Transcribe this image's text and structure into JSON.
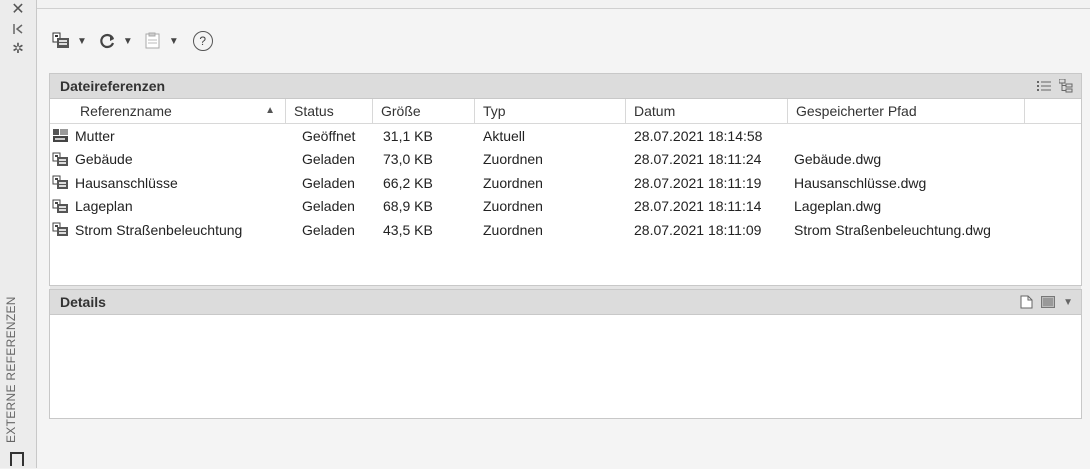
{
  "side": {
    "vertical_title": "EXTERNE REFERENZEN",
    "close_icon": "close-icon",
    "pin_icon": "pin-icon",
    "settings_icon": "settings-icon"
  },
  "toolbar": {
    "attach_icon": "attach-dwg-icon",
    "refresh_icon": "refresh-icon",
    "change_path_icon": "change-path-icon",
    "help_label": "?"
  },
  "file_refs": {
    "title": "Dateireferenzen",
    "columns": [
      "Referenzname",
      "Status",
      "Größe",
      "Typ",
      "Datum",
      "Gespeicherter Pfad"
    ],
    "rows": [
      {
        "name": "Mutter",
        "status": "Geöffnet",
        "size": "31,1 KB",
        "type": "Aktuell",
        "date": "28.07.2021 18:14:58",
        "path": ""
      },
      {
        "name": "Gebäude",
        "status": "Geladen",
        "size": "73,0 KB",
        "type": "Zuordnen",
        "date": "28.07.2021 18:11:24",
        "path": "Gebäude.dwg"
      },
      {
        "name": "Hausanschlüsse",
        "status": "Geladen",
        "size": "66,2 KB",
        "type": "Zuordnen",
        "date": "28.07.2021 18:11:19",
        "path": "Hausanschlüsse.dwg"
      },
      {
        "name": "Lageplan",
        "status": "Geladen",
        "size": "68,9 KB",
        "type": "Zuordnen",
        "date": "28.07.2021 18:11:14",
        "path": "Lageplan.dwg"
      },
      {
        "name": "Strom Straßenbeleuchtung",
        "status": "Geladen",
        "size": "43,5 KB",
        "type": "Zuordnen",
        "date": "28.07.2021 18:11:09",
        "path": "Strom Straßenbeleuchtung.dwg"
      }
    ],
    "splitter_label": "....."
  },
  "details": {
    "title": "Details"
  }
}
